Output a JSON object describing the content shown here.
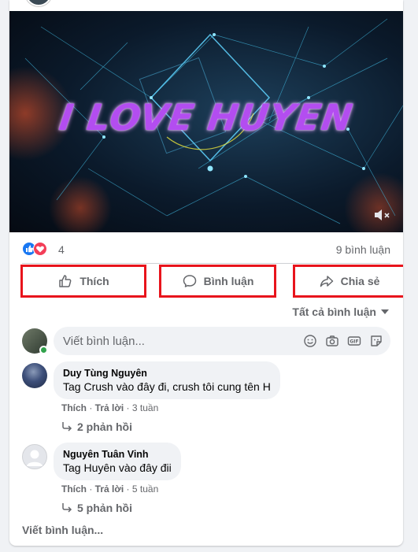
{
  "video": {
    "title": "I LOVE HUYEN"
  },
  "stats": {
    "reaction_count": "4",
    "comment_count": "9 bình luận"
  },
  "actions": {
    "like": "Thích",
    "comment": "Bình luận",
    "share": "Chia sẻ"
  },
  "filter": {
    "label": "Tất cả bình luận"
  },
  "composer": {
    "placeholder": "Viết bình luận..."
  },
  "comments": [
    {
      "name": "Duy Tùng Nguyên",
      "text": "Tag Crush vào đây đi, crush tôi cung tên H",
      "like": "Thích",
      "reply": "Trả lời",
      "time": "3 tuần",
      "replies": "2 phản hồi"
    },
    {
      "name": "Nguyên Tuân Vinh",
      "text": "Tag Huyên vào đây đii",
      "like": "Thích",
      "reply": "Trả lời",
      "time": "5 tuần",
      "replies": "5 phản hồi"
    }
  ],
  "more_comments": "Viết bình luận...",
  "colors": {
    "highlight": "#e8141c",
    "like_blue": "#1877f2",
    "love_red": "#f33e58",
    "online": "#31a24c"
  }
}
